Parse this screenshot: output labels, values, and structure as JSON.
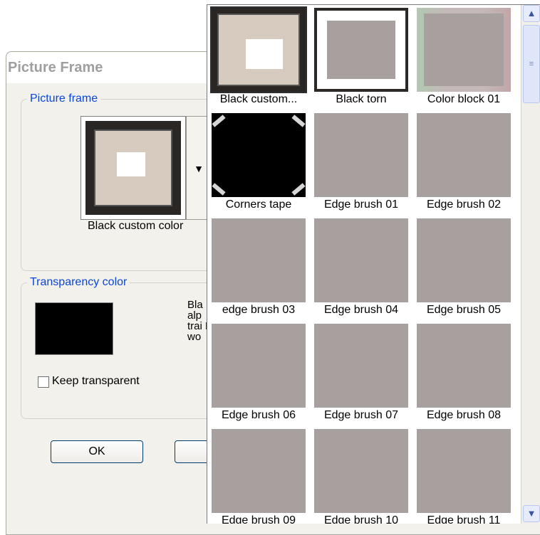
{
  "dialog": {
    "title": "Picture Frame",
    "picture_frame_group": "Picture frame",
    "selected_frame_name": "Black custom color",
    "transparency_group": "Transparency color",
    "transparency_color": "#000000",
    "info_text_fragment": "Bla alp trai Pl wo",
    "keep_transparent_label": "Keep transparent",
    "ok_label": "OK",
    "cancel_label_fragment": "C"
  },
  "popup": {
    "items": [
      {
        "label": "Black custom..."
      },
      {
        "label": "Black torn"
      },
      {
        "label": "Color block 01"
      },
      {
        "label": "Corners tape"
      },
      {
        "label": "Edge brush 01"
      },
      {
        "label": "Edge brush 02"
      },
      {
        "label": "edge brush 03"
      },
      {
        "label": "Edge brush 04"
      },
      {
        "label": "Edge brush 05"
      },
      {
        "label": "Edge brush 06"
      },
      {
        "label": "Edge brush 07"
      },
      {
        "label": "Edge brush 08"
      },
      {
        "label": "Edge brush 09"
      },
      {
        "label": "Edge brush 10"
      },
      {
        "label": "Edge brush 11"
      }
    ]
  },
  "scrollbar": {
    "up_icon": "chevron-up-icon",
    "down_icon": "chevron-down-icon"
  }
}
